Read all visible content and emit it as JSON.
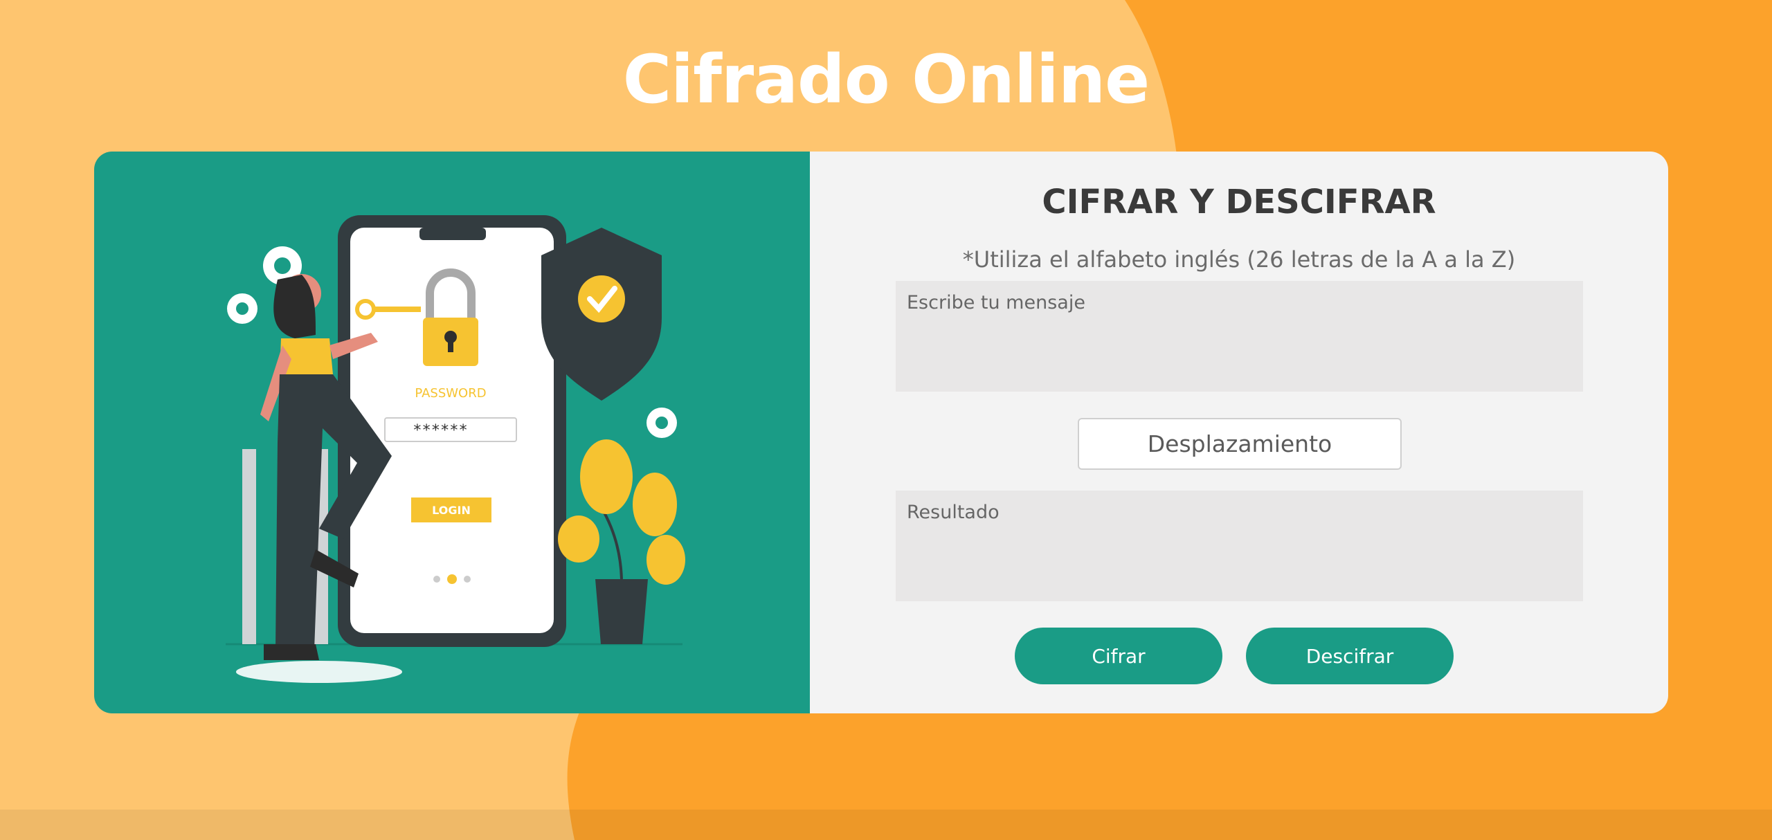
{
  "header": {
    "title": "Cifrado Online"
  },
  "illustration": {
    "screen_word": "PASSWORD",
    "password_mask": "******",
    "login_label": "LOGIN"
  },
  "form": {
    "title": "CIFRAR Y DESCIFRAR",
    "note": "*Utiliza el alfabeto inglés (26 letras de la A a la Z)",
    "message_placeholder": "Escribe tu mensaje",
    "shift_placeholder": "Desplazamiento",
    "result_placeholder": "Resultado",
    "encrypt_label": "Cifrar",
    "decrypt_label": "Descifrar"
  },
  "colors": {
    "background_light": "#FEC56F",
    "background_dark": "#FCA22B",
    "accent_green": "#1A9C86",
    "panel_bg": "#F3F3F3",
    "field_bg": "#E8E7E7"
  }
}
